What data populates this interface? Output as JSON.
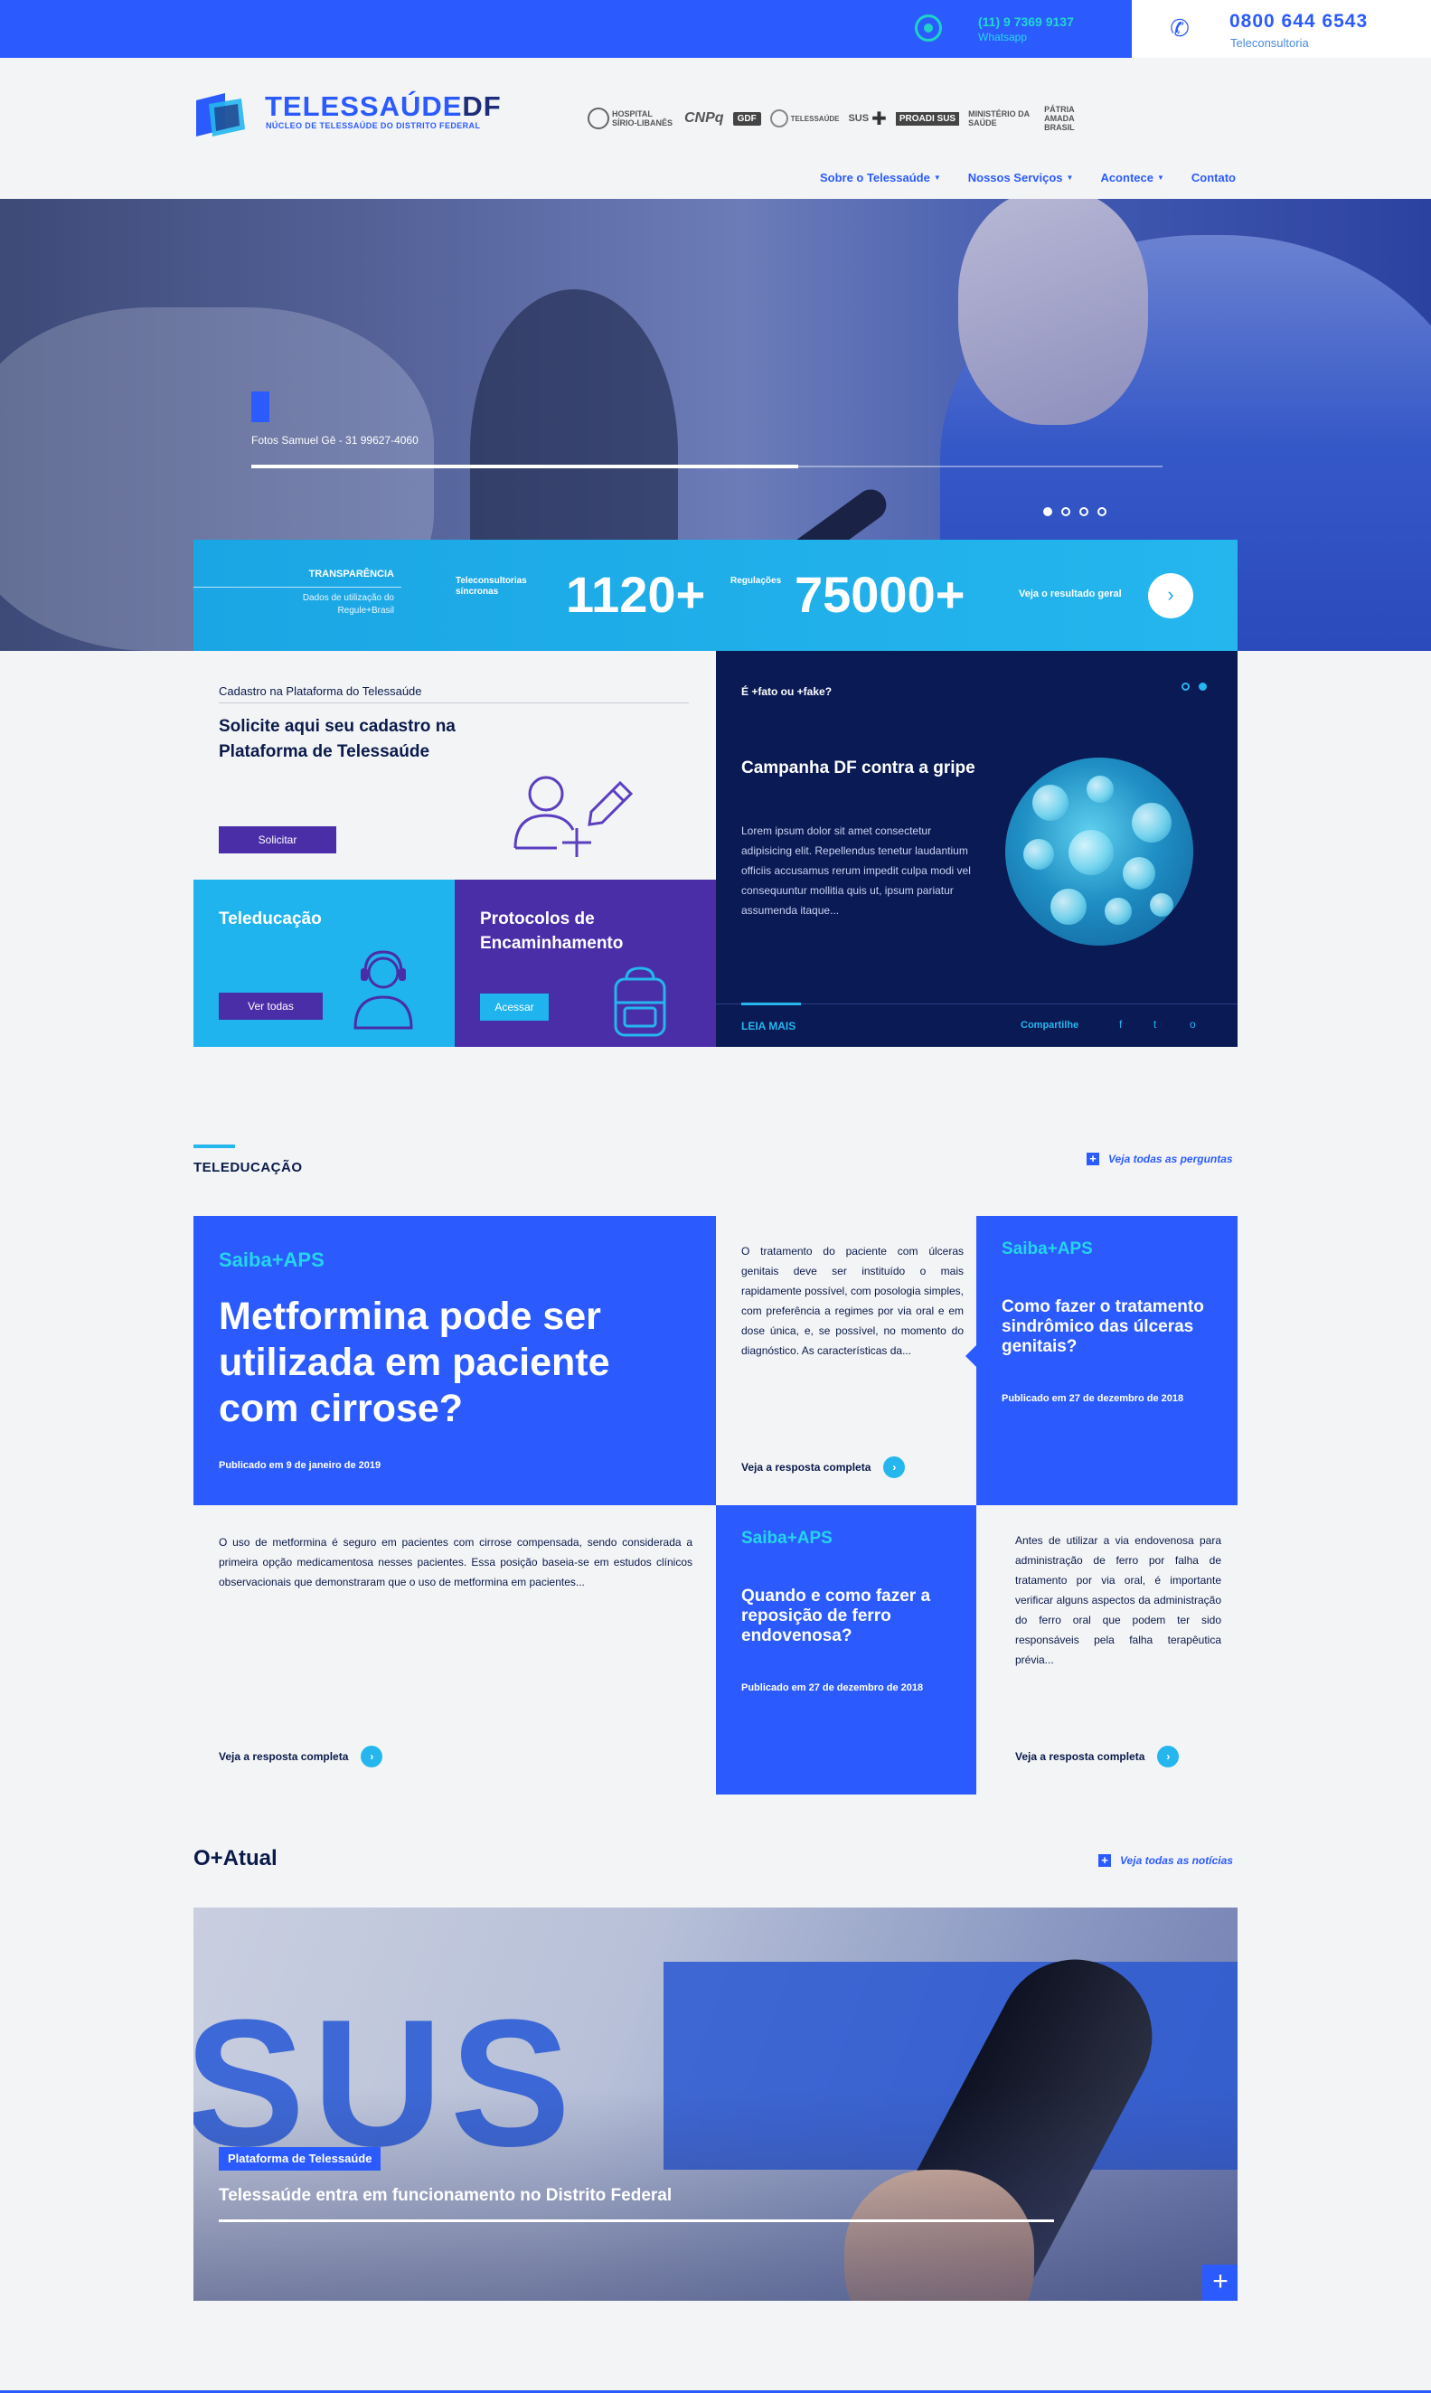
{
  "topbar": {
    "whatsapp_number": "(11) 9 7369 9137",
    "whatsapp_label": "Whatsapp",
    "phone_number": "0800 644 6543",
    "phone_label": "Teleconsultoria"
  },
  "header": {
    "logo_title_a": "TELESSAÚDE",
    "logo_title_b": "DF",
    "logo_subtitle": "NÚCLEO DE TELESSAÚDE DO DISTRITO FEDERAL",
    "partners": [
      {
        "label": "HOSPITAL SÍRIO-LIBANÊS",
        "icon": "hospital-seal-icon"
      },
      {
        "label": "CNPq",
        "icon": "cnpq-icon"
      },
      {
        "label": "GDF",
        "icon": "gdf-icon"
      },
      {
        "label": "TELESSAÚDE",
        "icon": "telessaude-icon"
      },
      {
        "label": "SUS",
        "icon": "sus-cross-icon"
      },
      {
        "label": "PROADI SUS",
        "icon": "proadi-icon"
      },
      {
        "label": "MINISTÉRIO DA SAÚDE",
        "icon": "ministerio-icon"
      },
      {
        "label": "PÁTRIA AMADA BRASIL",
        "icon": "brasil-icon"
      }
    ],
    "nav": [
      {
        "label": "Sobre o Telessaúde",
        "dropdown": true
      },
      {
        "label": "Nossos Serviços",
        "dropdown": true
      },
      {
        "label": "Acontece",
        "dropdown": true
      },
      {
        "label": "Contato",
        "dropdown": false
      }
    ]
  },
  "hero": {
    "caption": "Fotos Samuel Gê - 31 99627-4060",
    "progress": 0.6,
    "slides": 4,
    "active_slide": 0
  },
  "stats": {
    "transparency_title": "TRANSPARÊNCIA",
    "transparency_sub": "Dados de utilização do Regule+Brasil",
    "label_1": "Teleconsultorias síncronas",
    "value_1": "1120+",
    "label_2": "Regulações",
    "value_2": "75000+",
    "link": "Veja o resultado geral"
  },
  "cadastro": {
    "label": "Cadastro na Plataforma do Telessaúde",
    "title": "Solicite aqui seu cadastro na Plataforma de Telessaúde",
    "button": "Solicitar"
  },
  "campanha": {
    "label": "É +fato ou +fake?",
    "title": "Campanha DF contra a gripe",
    "body": "Lorem ipsum dolor sit amet consectetur adipisicing elit. Repellendus tenetur laudantium officiis accusamus rerum impedit culpa modi vel consequuntur mollitia quis ut, ipsum pariatur assumenda itaque...",
    "read_more": "LEIA MAIS",
    "share": "Compartilhe",
    "social": [
      "f",
      "t",
      "o"
    ]
  },
  "cards": {
    "teleducacao_title": "Teleducação",
    "teleducacao_button": "Ver todas",
    "protocolos_title": "Protocolos de Encaminhamento",
    "protocolos_button": "Acessar"
  },
  "teleducacao": {
    "section_title": "TELEDUCAÇÃO",
    "see_all": "Veja todas as perguntas",
    "items": [
      {
        "category": "Saiba+APS",
        "title": "Metformina pode ser utilizada em paciente com cirrose?",
        "date": "Publicado em 9 de janeiro de 2019",
        "excerpt": "O uso de metformina é seguro em pacientes com cirrose compensada, sendo considerada a primeira opção medicamentosa nesses pacientes. Essa posição baseia-se em estudos clínicos observacionais que demonstraram que o uso de metformina em pacientes...",
        "more": "Veja a resposta completa"
      },
      {
        "category": "Saiba+APS",
        "title": "Como fazer o tratamento sindrômico das úlceras genitais?",
        "date": "Publicado em 27 de dezembro de 2018",
        "excerpt": "O tratamento do paciente com úlceras genitais deve ser instituído o mais rapidamente possível, com posologia simples, com preferência a regimes por via oral e em dose única, e, se possível, no momento do diagnóstico. As características da...",
        "more": "Veja a resposta completa"
      },
      {
        "category": "Saiba+APS",
        "title": "Quando e como fazer a reposição de ferro endovenosa?",
        "date": "Publicado em 27 de dezembro de 2018",
        "excerpt": "Antes de utilizar a via endovenosa para administração de ferro por falha de tratamento por via oral, é importante verificar alguns aspectos da administração do ferro oral que podem ter sido responsáveis pela falha terapêutica prévia...",
        "more": "Veja a resposta completa"
      }
    ]
  },
  "atual": {
    "title": "O+Atual",
    "see_all": "Veja todas as notícias",
    "tag": "Plataforma de Telessaúde",
    "headline": "Telessaúde entra em funcionamento no Distrito Federal",
    "image_text": "SUS"
  },
  "colors": {
    "brand_blue": "#2b5bff",
    "cyan": "#25b6ee",
    "purple": "#4a2ea8",
    "navy": "#0a1a55"
  }
}
